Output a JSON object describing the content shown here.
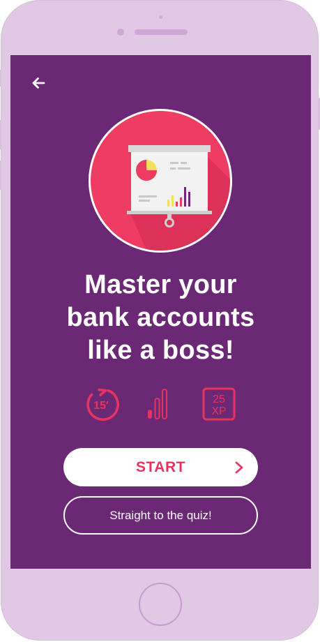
{
  "device": {
    "frame_color": "#e1c9e5",
    "screen_color": "#6a2875"
  },
  "header": {
    "back_icon": "arrow-left-icon"
  },
  "hero": {
    "icon": "presentation-board-icon",
    "circle_color": "#ee3c63"
  },
  "title": {
    "line1": "Master your",
    "line2": "bank accounts",
    "line3": "like a boss!"
  },
  "stats": {
    "duration_icon": "timer-icon",
    "duration_value": "15′",
    "difficulty_icon": "signal-bars-icon",
    "difficulty_level": 1,
    "difficulty_max": 3,
    "xp_icon": "xp-badge-icon",
    "xp_value": "25",
    "xp_unit": "XP"
  },
  "actions": {
    "start_label": "START",
    "start_icon": "chevron-right-icon",
    "quiz_label": "Straight to the quiz!"
  },
  "colors": {
    "accent": "#e7345f",
    "white": "#ffffff"
  }
}
